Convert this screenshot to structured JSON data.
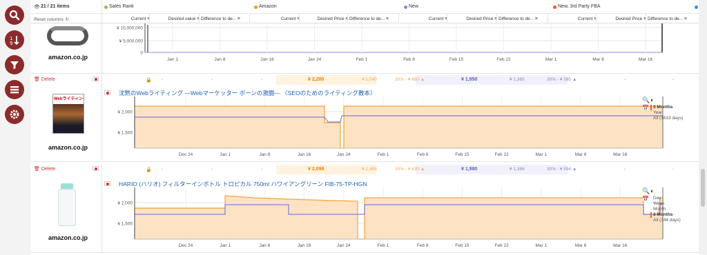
{
  "header": {
    "items_count": "21 / 21 items",
    "reset_columns": "Reset columns",
    "groups": [
      {
        "label": "Sales Rank",
        "color": "#8bc34a"
      },
      {
        "label": "Amazon",
        "color": "#ff9800"
      },
      {
        "label": "New",
        "color": "#8888dd"
      },
      {
        "label": "New, 3rd Party FBA",
        "color": "#ff5722"
      }
    ],
    "columns": [
      "Current",
      "Desired value",
      "Difference to de...",
      "Current",
      "Desired Price",
      "Difference to de...",
      "Current",
      "Desired Price",
      "Difference to de...",
      "Current",
      "Desired Price",
      "Difference to de..."
    ]
  },
  "top_chart": {
    "y_ticks": [
      "¥ 10,000,000",
      "¥ 5,000,000",
      "0"
    ],
    "x_ticks": [
      "Jan 1",
      "Jan 8",
      "Jan 16",
      "Jan 24",
      "Feb 1",
      "Feb 8",
      "Feb 15",
      "Feb 22",
      "Mar 1",
      "Mar 8",
      "Mar 16"
    ],
    "brand": "amazon.co.jp"
  },
  "products": [
    {
      "delete_label": "Delete",
      "row": {
        "sales_rank": "-",
        "desired_value": "-",
        "diff_rank": "-",
        "amazon_current": "¥ 2,200",
        "amazon_desired": "¥ 1,540",
        "amazon_diff": "30% - ¥ 660",
        "new_current": "¥ 1,950",
        "new_desired": "¥ 1,365",
        "new_diff": "30% - ¥ 585",
        "fba_current": "-",
        "fba_desired": "-",
        "fba_diff": "-"
      },
      "title": "沈黙のWebライティング —Webマーケッター ボーンの激闘— 〈SEOのためのライティング教本〉",
      "brand": "amazon.co.jp",
      "book_cover_text": "Webライティング",
      "y_ticks": [
        "¥ 2,000",
        "¥ 1,500"
      ],
      "x_ticks": [
        "Dec 24",
        "Jan 1",
        "Jan 8",
        "Jan 16",
        "Jan 24",
        "Feb 1",
        "Feb 8",
        "Feb 15",
        "Feb 22",
        "Mar 1",
        "Mar 8",
        "Mar 16"
      ],
      "range_options": [
        "3 Months",
        "Year",
        "All (1633 days)"
      ],
      "selected_range": "3 Months"
    },
    {
      "delete_label": "Delete",
      "row": {
        "sales_rank": "-",
        "desired_value": "-",
        "diff_rank": "-",
        "amazon_current": "¥ 2,098",
        "amazon_desired": "¥ 1,468",
        "amazon_diff": "30% - ¥ 630",
        "new_current": "¥ 1,980",
        "new_desired": "¥ 1,386",
        "new_diff": "30% - ¥ 594",
        "fba_current": "-",
        "fba_desired": "-",
        "fba_diff": "-"
      },
      "title": "HARIO (ハリオ) フィルターインボトル トロピカル 750ml ハワイアングリーン FIB-75-TP-HGN",
      "brand": "amazon.co.jp",
      "y_ticks": [
        "¥ 2,000",
        "¥ 1,500"
      ],
      "x_ticks": [
        "Dec 24",
        "Jan 1",
        "Jan 8",
        "Jan 16",
        "Jan 24",
        "Feb 1",
        "Feb 8",
        "Feb 15",
        "Feb 22",
        "Mar 1",
        "Mar 8",
        "Mar 16"
      ],
      "range_options": [
        "Day",
        "Week",
        "Month",
        "3 Months",
        "All (344 days)"
      ],
      "selected_range": "3 Months"
    }
  ],
  "icons": {
    "search": "search-icon",
    "sort": "sort-icon",
    "filter": "filter-icon",
    "columns": "columns-icon",
    "settings": "gear-icon"
  }
}
